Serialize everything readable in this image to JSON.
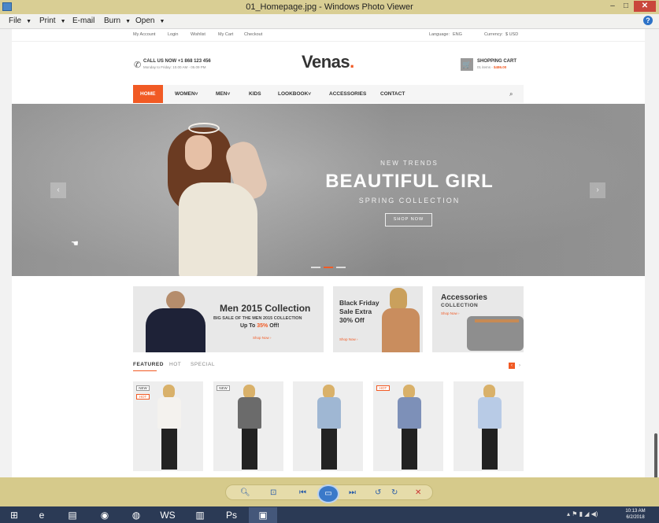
{
  "window": {
    "title": "01_Homepage.jpg - Windows Photo Viewer",
    "min": "–",
    "max": "□",
    "close": "✕"
  },
  "menu": {
    "items": [
      "File",
      "Print",
      "E-mail",
      "Burn",
      "Open"
    ],
    "help": "?"
  },
  "site": {
    "toplinks": [
      "My Account",
      "Login",
      "Wishlist",
      "My Cart",
      "Checkout"
    ],
    "language_label": "Language:",
    "language_value": "ENG",
    "currency_label": "Currency:",
    "currency_value": "$ USD",
    "callus_line1": "CALL US NOW  +1 868 123 456",
    "callus_line2": "Monday to Friday: 10.00 AM - 05.09 PM",
    "brand": "Venas",
    "brand_dot": ".",
    "cart_title": "SHOPPING CART",
    "cart_items": "01 items - ",
    "cart_total": "$486.00",
    "nav": [
      "HOME",
      "WOMEN",
      "MEN",
      "KIDS",
      "LOOKBOOK",
      "ACCESSORIES",
      "CONTACT"
    ],
    "nav_dropdowns": [
      "",
      "˅",
      "˅",
      "",
      "˅",
      "",
      ""
    ],
    "hero": {
      "kicker": "NEW TRENDS",
      "headline": "BEAUTIFUL GIRL",
      "sub": "SPRING COLLECTION",
      "cta": "SHOP NOW",
      "prev": "‹",
      "next": "›"
    },
    "promo1": {
      "title": "Men 2015 Collection",
      "sub": "BIG SALE OF THE MEN 2015 COLLECTION",
      "offer_pre": "Up To ",
      "offer_pct": "35%",
      "offer_post": " Off!",
      "link": "Shop Now ›"
    },
    "promo2": {
      "title": "Black Friday Sale Extra 30% Off",
      "link": "Shop Now ›"
    },
    "promo3": {
      "title": "Accessories",
      "sub": "COLLECTION",
      "link": "Shop Now ›"
    },
    "tabs": [
      "FEATURED",
      "HOT",
      "SPECIAL"
    ],
    "products": [
      {
        "badges": [
          "NEW",
          "HOT"
        ],
        "top_color": "#f4f2ee"
      },
      {
        "badges": [
          "NEW"
        ],
        "top_color": "#6b6b6b"
      },
      {
        "badges": [],
        "top_color": "#9fb7d3"
      },
      {
        "badges": [
          "HOT"
        ],
        "top_color": "#7d90b8"
      },
      {
        "badges": [],
        "top_color": "#b8cbe6"
      }
    ]
  },
  "taskbar": {
    "time": "10:13 AM",
    "date": "6/2/2018",
    "apps": [
      "start",
      "ie",
      "files",
      "chrome",
      "firefox",
      "webstorm",
      "notepad",
      "photoshop",
      "photo-viewer"
    ]
  },
  "colors": {
    "accent": "#f15a24",
    "chrome": "#d7cc8f"
  }
}
